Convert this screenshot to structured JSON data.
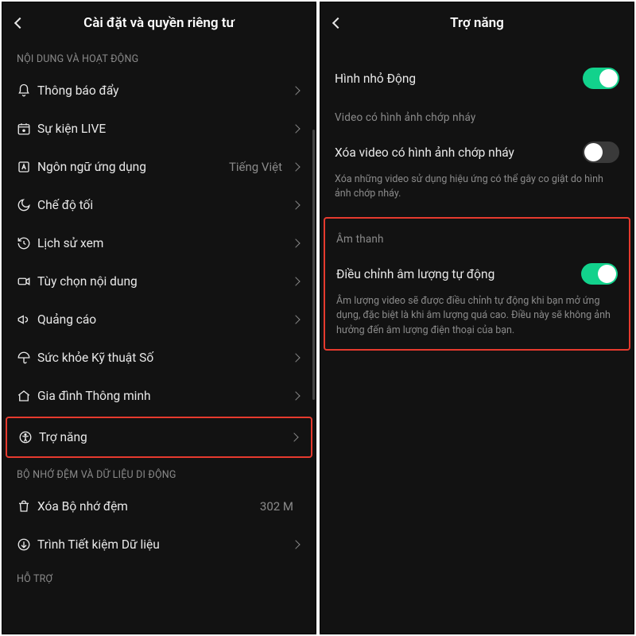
{
  "left": {
    "title": "Cài đặt và quyền riêng tư",
    "section1_header": "NỘI DUNG VÀ HOẠT ĐỘNG",
    "items": [
      {
        "icon": "bell",
        "label": "Thông báo đẩy"
      },
      {
        "icon": "live",
        "label": "Sự kiện LIVE"
      },
      {
        "icon": "lang",
        "label": "Ngôn ngữ ứng dụng",
        "value": "Tiếng Việt"
      },
      {
        "icon": "moon",
        "label": "Chế độ tối"
      },
      {
        "icon": "history",
        "label": "Lịch sử xem"
      },
      {
        "icon": "video",
        "label": "Tùy chọn nội dung"
      },
      {
        "icon": "megaphone",
        "label": "Quảng cáo"
      },
      {
        "icon": "umbrella",
        "label": "Sức khỏe Kỹ thuật Số"
      },
      {
        "icon": "home",
        "label": "Gia đình Thông minh"
      }
    ],
    "highlight_item": {
      "icon": "accessibility",
      "label": "Trợ năng"
    },
    "section2_header": "BỘ NHỚ ĐỆM VÀ DỮ LIỆU DI ĐỘNG",
    "items2": [
      {
        "icon": "trash",
        "label": "Xóa Bộ nhớ đệm",
        "value": "302 M"
      },
      {
        "icon": "datasaver",
        "label": "Trình Tiết kiệm Dữ liệu"
      }
    ],
    "section3_header": "HỖ TRỢ"
  },
  "right": {
    "title": "Trợ năng",
    "animated_thumb": {
      "label": "Hình nhỏ Động",
      "on": true
    },
    "flashing_header": "Video có hình ảnh chớp nháy",
    "flashing_toggle": {
      "label": "Xóa video có hình ảnh chớp nháy",
      "on": false
    },
    "flashing_desc": "Xóa những video sử dụng hiệu ứng có thể gây co giật do hình ảnh chớp nháy.",
    "highlight": {
      "header": "Âm thanh",
      "toggle": {
        "label": "Điều chỉnh âm lượng tự động",
        "on": true
      },
      "desc": "Âm lượng video sẽ được điều chỉnh tự động khi bạn mở ứng dụng, đặc biệt là khi âm lượng quá cao. Điều này sẽ không ảnh hưởng đến âm lượng điện thoại của bạn."
    }
  }
}
